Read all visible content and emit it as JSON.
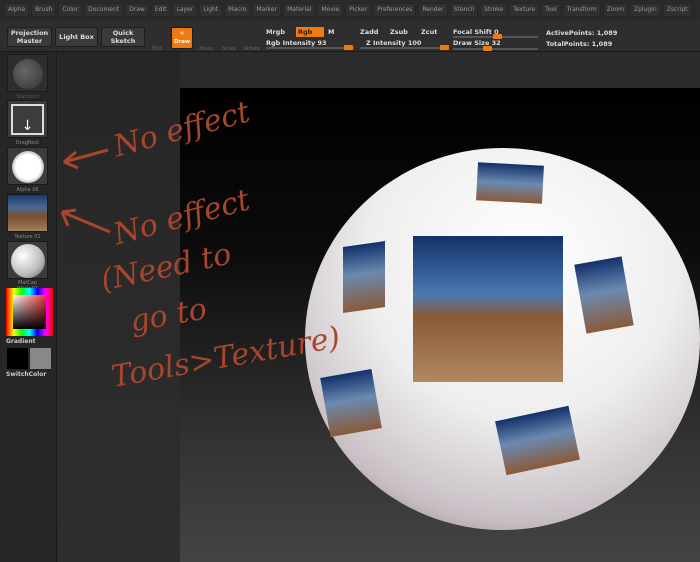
{
  "menu": [
    "Alpha",
    "Brush",
    "Color",
    "Document",
    "Draw",
    "Edit",
    "Layer",
    "Light",
    "Macro",
    "Marker",
    "Material",
    "Movie",
    "Picker",
    "Preferences",
    "Render",
    "Stencil",
    "Stroke",
    "Texture",
    "Tool",
    "Transform",
    "Zoom",
    "Zplugin",
    "Zscript"
  ],
  "toolbar": {
    "projection_master": "Projection Master",
    "light_box": "Light Box",
    "quick_sketch": "Quick Sketch",
    "edit": "Edit",
    "draw": "Draw",
    "move": "Move",
    "scale": "Scale",
    "rotate": "Rotate",
    "mrgb": "Mrgb",
    "rgb": "Rgb",
    "m": "M",
    "rgb_intensity_label": "Rgb Intensity",
    "rgb_intensity": "93",
    "zadd": "Zadd",
    "zsub": "Zsub",
    "zcut": "Zcut",
    "z_intensity_label": "Z Intensity",
    "z_intensity": "100",
    "focal_shift_label": "Focal Shift",
    "focal_shift": "0",
    "draw_size_label": "Draw Size",
    "draw_size": "32",
    "active_points": "ActivePoints: 1,089",
    "total_points": "TotalPoints: 1,089",
    "accent": "#f07a10"
  },
  "left": {
    "brush": "Standard",
    "stroke": "DragRect",
    "alpha": "Alpha 06",
    "texture": "Texture 01",
    "material": "MatCap White01",
    "gradient": "Gradient",
    "switch_color": "SwitchColor"
  },
  "annotations": {
    "a1": "No effect",
    "a2": "No effect",
    "a3": "(Need to",
    "a4": "go to",
    "a5": "Tools>Texture)"
  }
}
